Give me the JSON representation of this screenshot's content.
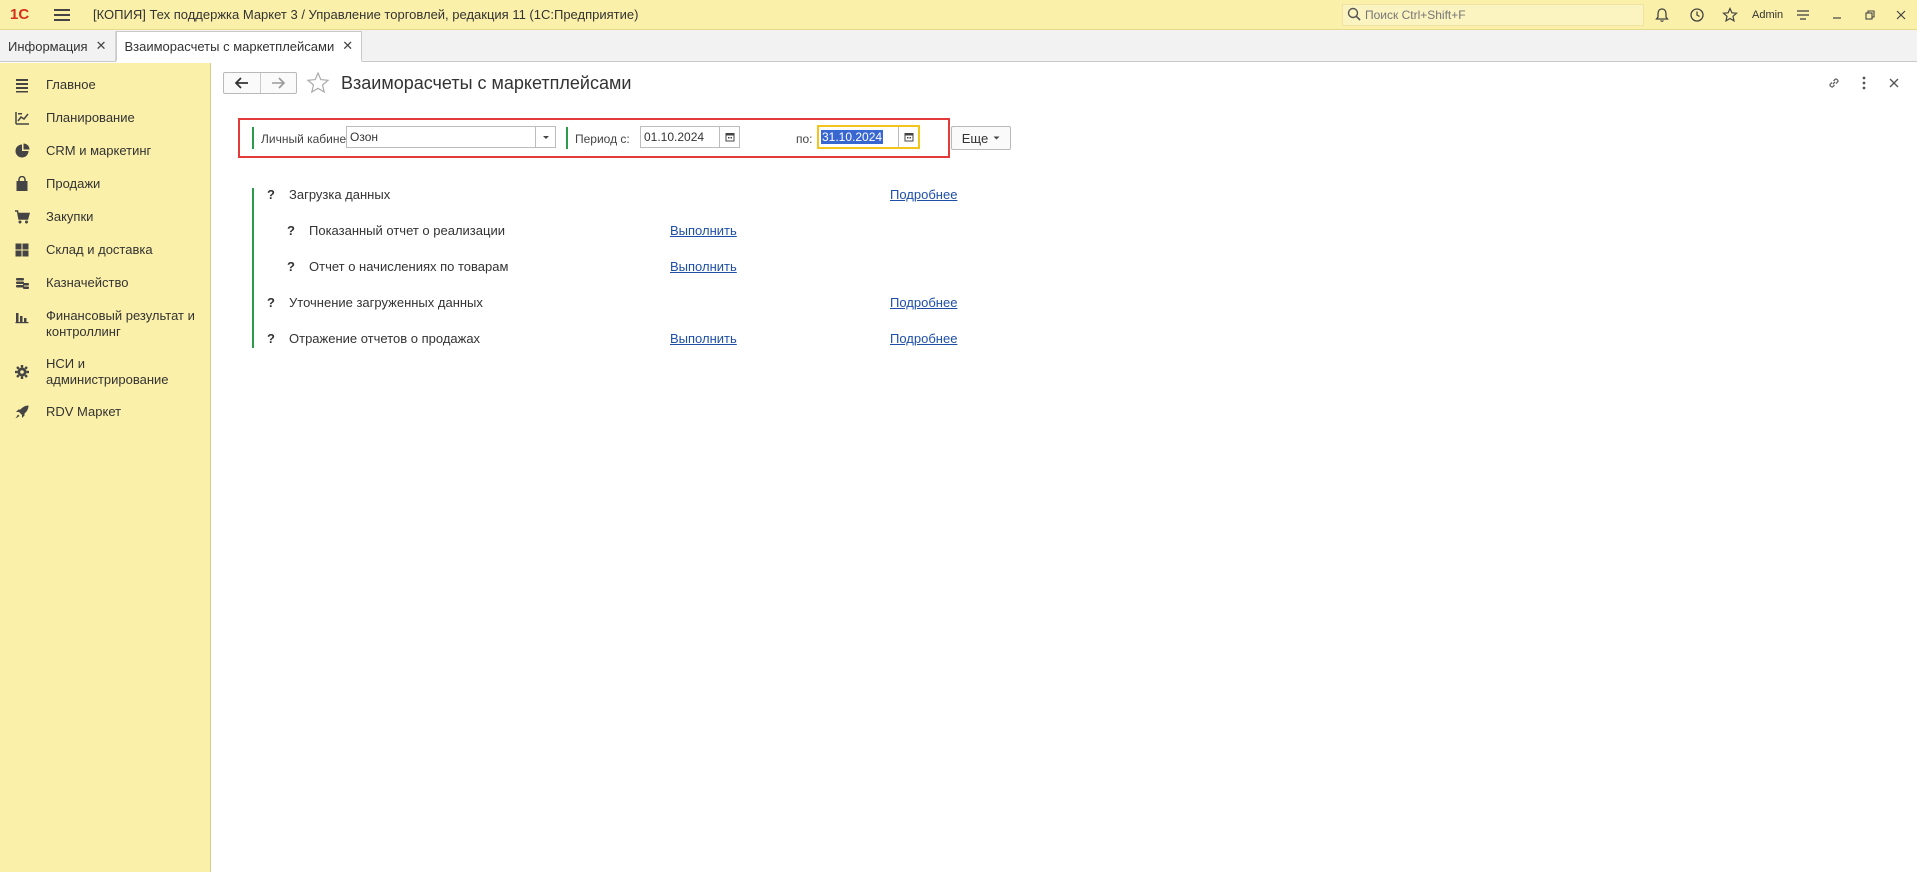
{
  "titlebar": {
    "logo": "1С",
    "title": "[КОПИЯ] Тех поддержка Маркет 3 / Управление торговлей, редакция 11  (1С:Предприятие)",
    "search_placeholder": "Поиск Ctrl+Shift+F",
    "user": "Admin"
  },
  "tabs": [
    {
      "label": "Информация"
    },
    {
      "label": "Взаиморасчеты с маркетплейсами"
    }
  ],
  "sidebar": {
    "items": [
      {
        "label": "Главное",
        "icon": "list-icon"
      },
      {
        "label": "Планирование",
        "icon": "planning-icon"
      },
      {
        "label": "CRM и маркетинг",
        "icon": "pie-icon"
      },
      {
        "label": "Продажи",
        "icon": "bag-icon"
      },
      {
        "label": "Закупки",
        "icon": "cart-icon"
      },
      {
        "label": "Склад и доставка",
        "icon": "grid-icon"
      },
      {
        "label": "Казначейство",
        "icon": "coins-icon"
      },
      {
        "label": "Финансовый результат и контроллинг",
        "icon": "bar-chart-icon"
      },
      {
        "label": "НСИ и администрирование",
        "icon": "gear-icon"
      },
      {
        "label": "RDV Маркет",
        "icon": "rocket-icon"
      }
    ]
  },
  "page": {
    "title": "Взаиморасчеты с маркетплейсами"
  },
  "filter": {
    "account_label": "Личный кабинет:",
    "account_value": "Озон",
    "period_from_label": "Период с:",
    "period_from_value": "01.10.2024",
    "period_to_label": "по:",
    "period_to_value": "31.10.2024",
    "more_label": "Еще"
  },
  "tasks": {
    "qmark": "?",
    "run_label": "Выполнить",
    "details_label": "Подробнее",
    "items": [
      {
        "label": "Загрузка данных"
      },
      {
        "label": "Показанный отчет о реализации"
      },
      {
        "label": "Отчет о начислениях по товарам"
      },
      {
        "label": "Уточнение загруженных данных"
      },
      {
        "label": "Отражение отчетов о продажах"
      }
    ]
  }
}
